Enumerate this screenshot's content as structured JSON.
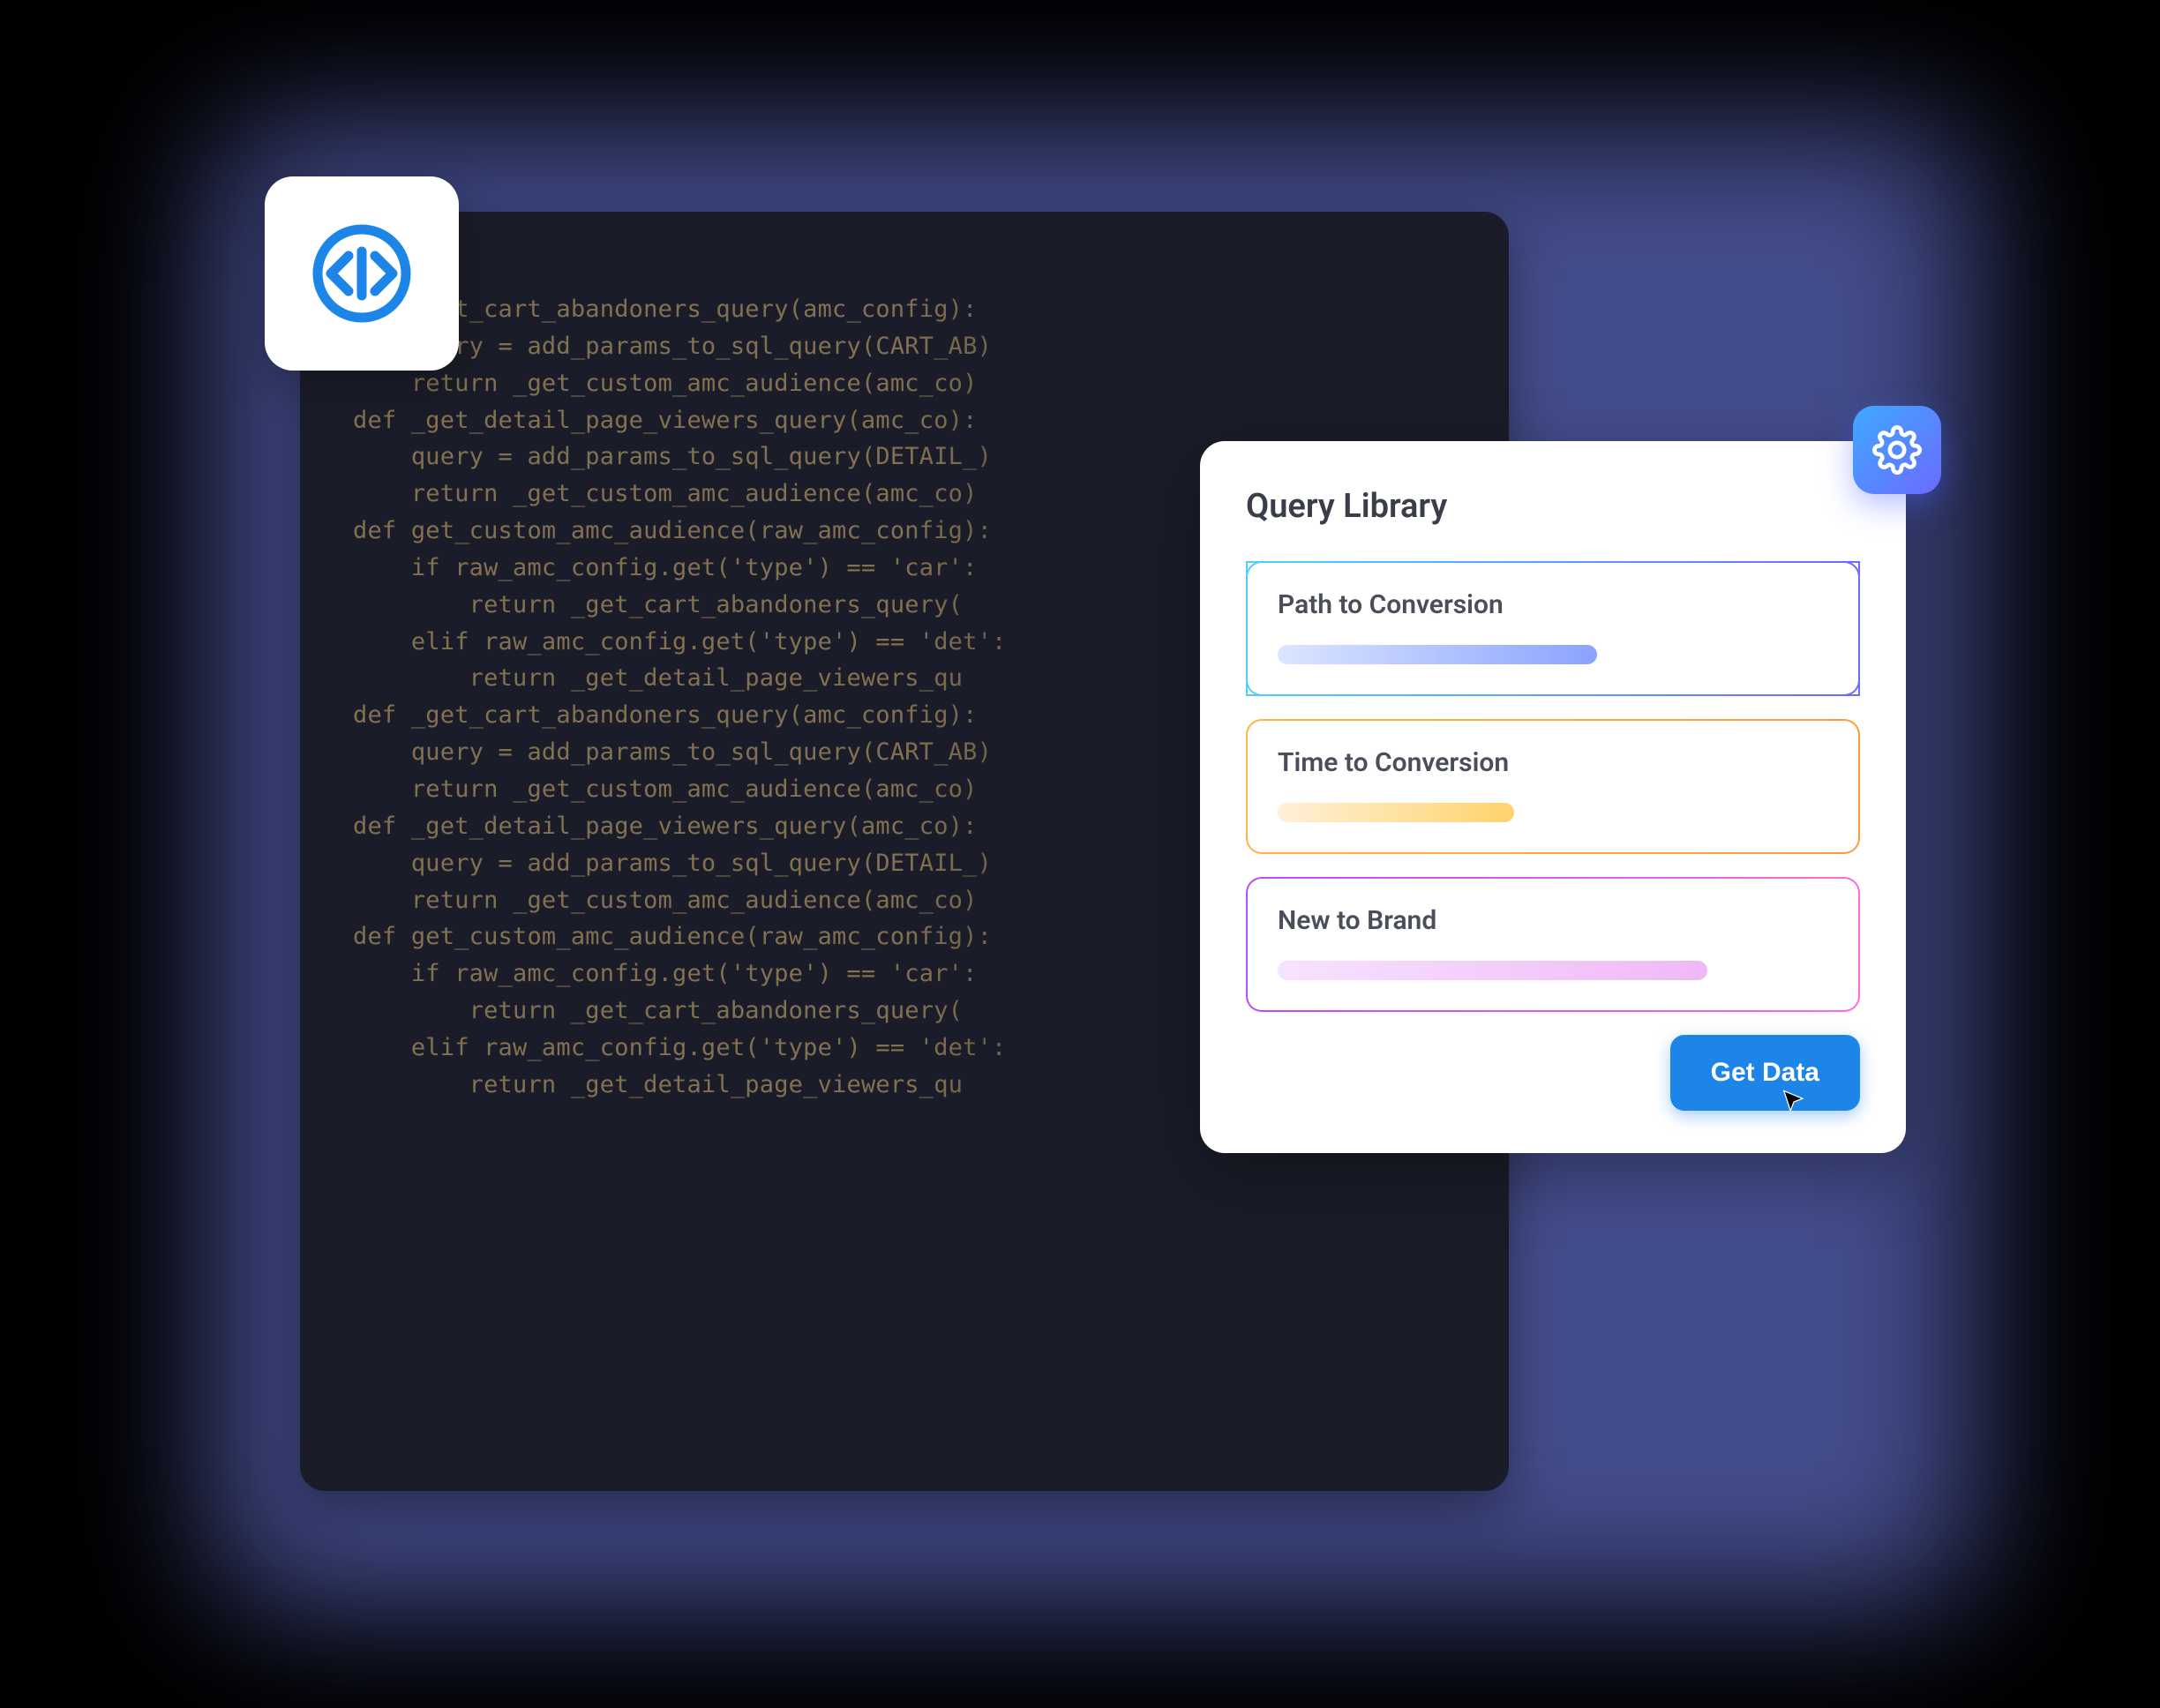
{
  "code": {
    "lines": [
      "def _get_cart_abandoners_query(amc_config):",
      "    query = add_params_to_sql_query(CART_AB)",
      "    return _get_custom_amc_audience(amc_co)",
      "",
      "def _get_detail_page_viewers_query(amc_co):",
      "    query = add_params_to_sql_query(DETAIL_)",
      "    return _get_custom_amc_audience(amc_co)",
      "",
      "def get_custom_amc_audience(raw_amc_config):",
      "    if raw_amc_config.get('type') == 'car':",
      "        return _get_cart_abandoners_query(",
      "    elif raw_amc_config.get('type') == 'det':",
      "        return _get_detail_page_viewers_qu",
      "",
      "def _get_cart_abandoners_query(amc_config):",
      "    query = add_params_to_sql_query(CART_AB)",
      "    return _get_custom_amc_audience(amc_co)",
      "",
      "def _get_detail_page_viewers_query(amc_co):",
      "    query = add_params_to_sql_query(DETAIL_)",
      "    return _get_custom_amc_audience(amc_co)",
      "",
      "def get_custom_amc_audience(raw_amc_config):",
      "    if raw_amc_config.get('type') == 'car':",
      "        return _get_cart_abandoners_query(",
      "    elif raw_amc_config.get('type') == 'det':",
      "        return _get_detail_page_viewers_qu"
    ]
  },
  "queryLibrary": {
    "title": "Query Library",
    "items": [
      {
        "label": "Path to Conversion"
      },
      {
        "label": "Time to Conversion"
      },
      {
        "label": "New to Brand"
      }
    ],
    "button": "Get Data"
  },
  "icons": {
    "code": "code-icon",
    "gear": "gear-icon"
  },
  "colors": {
    "accent": "#1d85e8",
    "glow": "#7c8cff"
  }
}
